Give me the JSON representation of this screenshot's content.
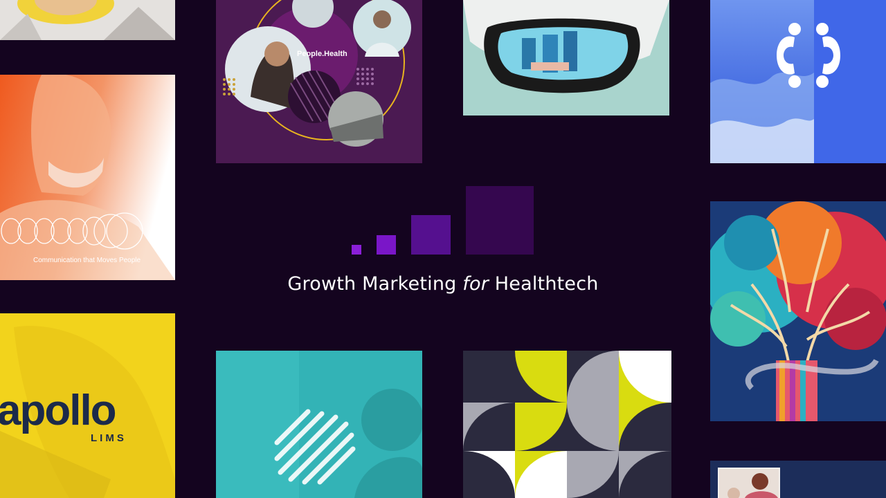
{
  "headline": {
    "before": "Growth Marketing ",
    "italic": "for",
    "after": " Healthtech"
  },
  "tiles": {
    "people_health": {
      "label": "People.Health"
    },
    "orange": {
      "tagline": "Communication that Moves People"
    },
    "apollo": {
      "wordmark": "apollo",
      "sub": "LIMS"
    }
  },
  "colors": {
    "background": "#14041f",
    "bar_1": "#8b1fd8",
    "bar_2": "#7a16c8",
    "bar_3": "#55108f",
    "bar_4": "#35074f",
    "purple_tile": "#4b1a52",
    "orange_tile": "#ef6a2a",
    "yellow_tile": "#f2d31c",
    "teal_tile": "#34b5b8",
    "blue_tile": "#3b63e6",
    "lime": "#d9dc10",
    "navy": "#2b2a3e"
  },
  "icons": [
    "growth-bars-icon",
    "people-ring-icon",
    "stripes-logo-icon"
  ]
}
